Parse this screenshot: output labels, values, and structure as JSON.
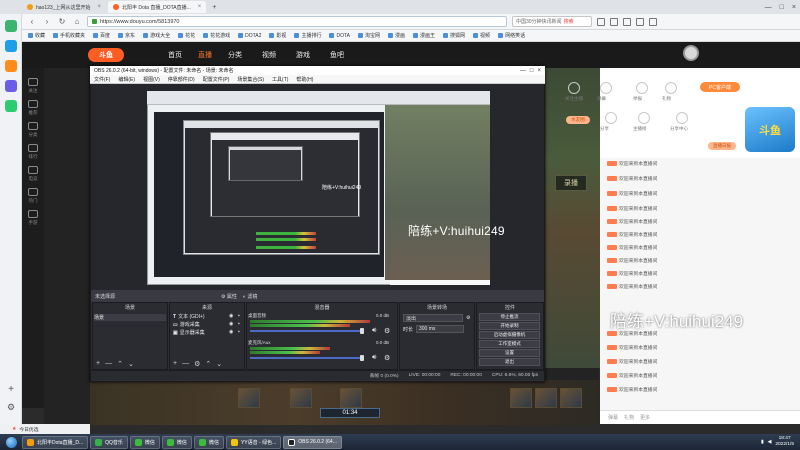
{
  "browser": {
    "tabs": [
      {
        "label": "hao123_上网从这里开始",
        "active": false
      },
      {
        "label": "北阳丰 Dota 直播_DOTA直播...",
        "active": true
      }
    ],
    "url": "https://www.douyu.com/5813970",
    "search_text": "中国30分钟快讯新闻",
    "search_badge": "搜索",
    "bookmarks": [
      "收藏",
      "手机收藏夹",
      "百度",
      "京东",
      "游戏大全",
      "花花",
      "花花游戏",
      "DOTA2",
      "影视",
      "主播排行",
      "DOTA",
      "淘宝网",
      "漫画",
      "漫画王",
      "搜狐网",
      "视频",
      "网络笑话"
    ]
  },
  "site": {
    "logo": "斗鱼",
    "nav": [
      "首页",
      "直播",
      "分类",
      "视频",
      "游戏",
      "鱼吧"
    ],
    "side_nav": [
      "关注",
      "推荐",
      "分类",
      "排行",
      "电竞",
      "热门",
      "手游"
    ]
  },
  "obs": {
    "title": "OBS 26.0.2 (64-bit, windows) - 配置文件: 未命名 - 场景: 未命名",
    "menu": [
      "文件(F)",
      "编辑(E)",
      "视图(V)",
      "停靠部件(D)",
      "配置文件(P)",
      "场景集合(S)",
      "工具(T)",
      "帮助(H)"
    ],
    "source_bar": {
      "label": "未选择源",
      "props": "属性",
      "filters": "滤镜"
    },
    "docks": {
      "scenes": {
        "header": "场景",
        "items": [
          "场景"
        ]
      },
      "sources": {
        "header": "来源",
        "items": [
          "文本 (GDI+)",
          "游戏采集",
          "显示器采集"
        ]
      },
      "mixer": {
        "header": "混音器",
        "tracks": [
          {
            "name": "桌面音频",
            "db": "0.0 dB"
          },
          {
            "name": "麦克风/Aux",
            "db": "0.0 dB"
          }
        ]
      },
      "transitions": {
        "header": "场景转场",
        "type": "淡出",
        "duration_label": "时长",
        "duration": "300 ms"
      },
      "controls": {
        "header": "控件",
        "buttons": [
          "停止推流",
          "开始录制",
          "启动虚拟摄像机",
          "工作室模式",
          "设置",
          "退出"
        ]
      }
    },
    "status": {
      "dropped": "丢帧 0 (0.0%)",
      "live": "LIVE: 00:00:00",
      "rec": "REC: 00:00:00",
      "cpu": "CPU: 6.6%, 60.00 fps"
    }
  },
  "stream": {
    "watermark": "陪练+V:huihui249",
    "watermark_small": "陪练+V:huihui249",
    "mid_watermark": "陪练+V:huihui249",
    "score": "01:34",
    "overlay_label": "录播"
  },
  "chat": {
    "pc_button": "PC客户端",
    "pills": [
      "水友圈",
      "直播日报"
    ],
    "top_icons": [
      "关注主播",
      "弹幕",
      "举报",
      "礼物",
      "分享",
      "主播榜",
      "分享中心",
      "更多"
    ],
    "messages": [
      {
        "user": "",
        "text": "欢迎来到本直播间"
      },
      {
        "user": "",
        "text": "欢迎来到本直播间"
      },
      {
        "user": "",
        "text": "欢迎来到本直播间"
      },
      {
        "user": "",
        "text": "欢迎来到本直播间"
      },
      {
        "user": "",
        "text": "欢迎来到本直播间"
      },
      {
        "user": "",
        "text": "欢迎来到本直播间"
      },
      {
        "user": "",
        "text": "欢迎来到本直播间"
      },
      {
        "user": "",
        "text": "欢迎来到本直播间"
      },
      {
        "user": "",
        "text": "欢迎来到本直播间"
      },
      {
        "user": "",
        "text": "欢迎来到本直播间"
      }
    ],
    "bottom": [
      "弹幕",
      "礼物",
      "更多"
    ]
  },
  "status_bottom_left": "今日优选",
  "taskbar": {
    "items": [
      {
        "label": "北阳丰Dota直播_D...",
        "color": "#f39c12",
        "on": false
      },
      {
        "label": "QQ音乐",
        "color": "#35b14a",
        "on": false
      },
      {
        "label": "微信",
        "color": "#3dbb3d",
        "on": false
      },
      {
        "label": "微信",
        "color": "#3dbb3d",
        "on": false
      },
      {
        "label": "微信",
        "color": "#3dbb3d",
        "on": false
      },
      {
        "label": "YY语音 - 绿色...",
        "color": "#f2c40f",
        "on": false
      },
      {
        "label": "OBS 26.0.2 (64...",
        "color": "#222",
        "on": true
      }
    ],
    "time": "18:47",
    "date": "2022/1/5"
  }
}
